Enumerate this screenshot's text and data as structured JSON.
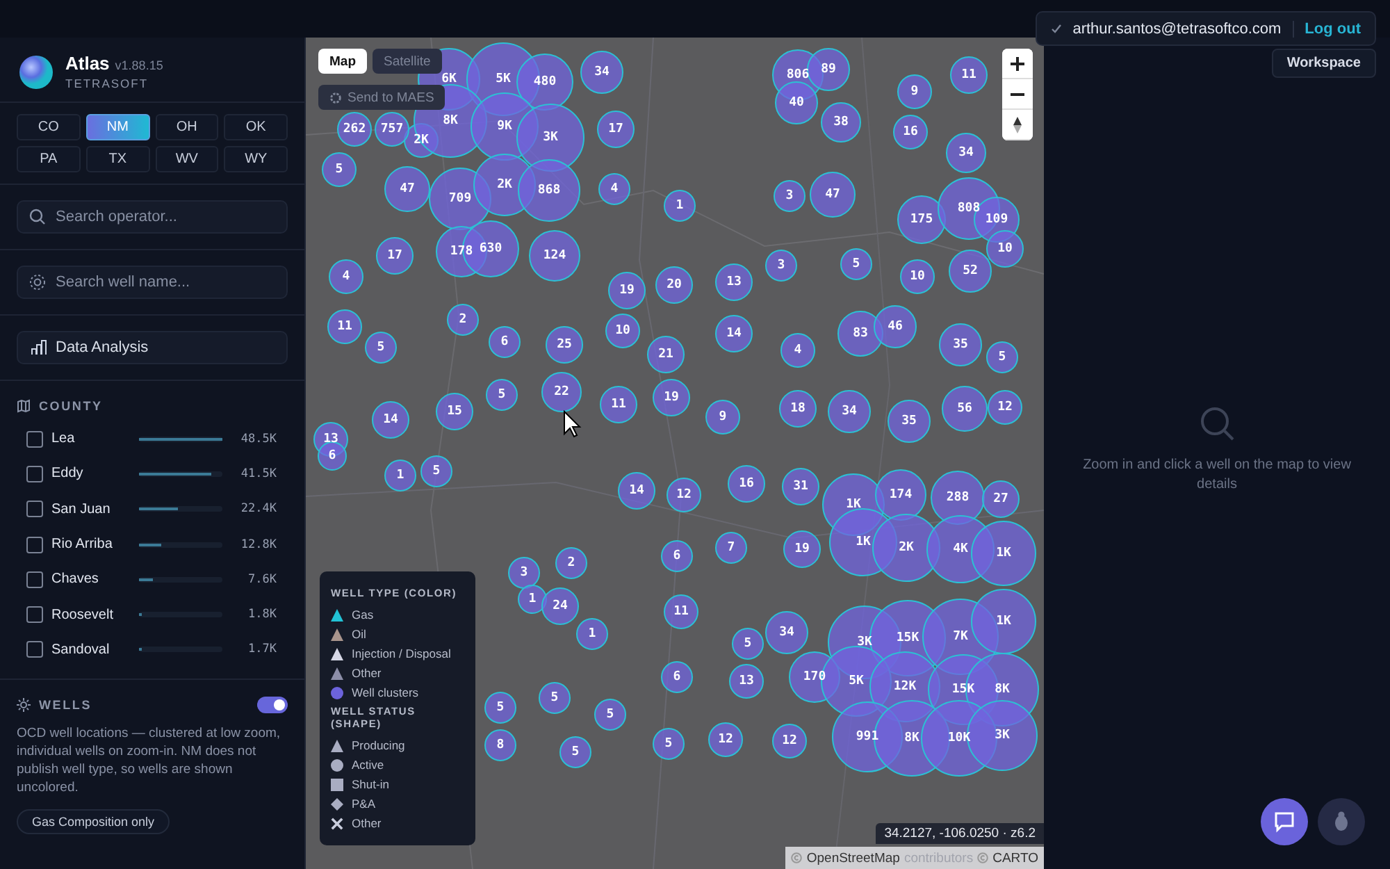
{
  "app": {
    "name": "Atlas",
    "version": "v1.88.15",
    "company": "TETRASOFT"
  },
  "user": {
    "email": "arthur.santos@tetrasoftco.com",
    "logout": "Log out",
    "workspace": "Workspace"
  },
  "states": [
    {
      "label": "CO",
      "selected": false
    },
    {
      "label": "NM",
      "selected": true
    },
    {
      "label": "OH",
      "selected": false
    },
    {
      "label": "OK",
      "selected": false
    },
    {
      "label": "PA",
      "selected": false
    },
    {
      "label": "TX",
      "selected": false
    },
    {
      "label": "WV",
      "selected": false
    },
    {
      "label": "WY",
      "selected": false
    }
  ],
  "search_operator": {
    "placeholder": "Search operator..."
  },
  "search_well": {
    "placeholder": "Search well name..."
  },
  "data_analysis": "Data Analysis",
  "county": {
    "title": "COUNTY",
    "rows": [
      {
        "name": "Lea",
        "checked": false,
        "level": 1.0,
        "count": "48.5K"
      },
      {
        "name": "Eddy",
        "checked": false,
        "level": 0.86,
        "count": "41.5K"
      },
      {
        "name": "San Juan",
        "checked": false,
        "level": 0.46,
        "count": "22.4K"
      },
      {
        "name": "Rio Arriba",
        "checked": false,
        "level": 0.26,
        "count": "12.8K"
      },
      {
        "name": "Chaves",
        "checked": false,
        "level": 0.16,
        "count": "7.6K"
      },
      {
        "name": "Roosevelt",
        "checked": false,
        "level": 0.04,
        "count": "1.8K"
      },
      {
        "name": "Sandoval",
        "checked": false,
        "level": 0.035,
        "count": "1.7K"
      }
    ]
  },
  "wells": {
    "title": "WELLS",
    "on": true,
    "description": "OCD well locations — clustered at low zoom, individual wells on zoom-in. NM does not publish well type, so wells are shown uncolored.",
    "chip": "Gas Composition only"
  },
  "map": {
    "tabs": [
      {
        "label": "Map",
        "selected": true
      },
      {
        "label": "Satellite",
        "selected": false
      }
    ],
    "send": "Send to MAES",
    "clusters": [
      "2K",
      "6K",
      "5K",
      "480",
      "34",
      "262",
      "757",
      "8K",
      "9K",
      "3K",
      "17",
      "806",
      "89",
      "40",
      "38",
      "11",
      "9",
      "16",
      "34",
      "5",
      "47",
      "709",
      "2K",
      "868",
      "4",
      "1",
      "3",
      "47",
      "175",
      "808",
      "109",
      "10",
      "17",
      "178",
      "630",
      "124",
      "4",
      "19",
      "20",
      "13",
      "3",
      "5",
      "10",
      "52",
      "11",
      "5",
      "2",
      "6",
      "25",
      "10",
      "21",
      "14",
      "4",
      "83",
      "46",
      "35",
      "5",
      "14",
      "15",
      "5",
      "22",
      "11",
      "19",
      "9",
      "18",
      "34",
      "35",
      "56",
      "12",
      "13",
      "6",
      "1",
      "5",
      "14",
      "12",
      "16",
      "31",
      "1K",
      "174",
      "288",
      "27",
      "3",
      "2",
      "1",
      "24",
      "1",
      "6",
      "7",
      "19",
      "1K",
      "2K",
      "4K",
      "1K",
      "11",
      "34",
      "5",
      "3K",
      "15K",
      "7K",
      "1K",
      "6",
      "13",
      "170",
      "5K",
      "12K",
      "15K",
      "8K",
      "5",
      "5",
      "5",
      "8",
      "5",
      "5",
      "12",
      "12",
      "991",
      "8K",
      "10K",
      "3K"
    ],
    "legend": {
      "type_title": "WELL TYPE (COLOR)",
      "types": [
        {
          "label": "Gas",
          "kind": "triangle",
          "color": "#22c3d6"
        },
        {
          "label": "Oil",
          "kind": "triangle",
          "color": "#a8948c"
        },
        {
          "label": "Injection / Disposal",
          "kind": "triangle",
          "color": "#d6d8e6"
        },
        {
          "label": "Other",
          "kind": "triangle",
          "color": "#8c8ea8"
        },
        {
          "label": "Well clusters",
          "kind": "circle",
          "color": "#6c63dc"
        }
      ],
      "status_title": "WELL STATUS (SHAPE)",
      "statuses": [
        {
          "label": "Producing",
          "kind": "triangle"
        },
        {
          "label": "Active",
          "kind": "circle"
        },
        {
          "label": "Shut-in",
          "kind": "square"
        },
        {
          "label": "P&A",
          "kind": "diamond"
        },
        {
          "label": "Other",
          "kind": "x"
        }
      ]
    },
    "coords": "34.2127, -106.0250 · z6.2",
    "attribution": [
      "OpenStreetMap",
      "contributors",
      "CARTO"
    ]
  },
  "details": {
    "empty": "Zoom in and click a well on the map to view details"
  }
}
